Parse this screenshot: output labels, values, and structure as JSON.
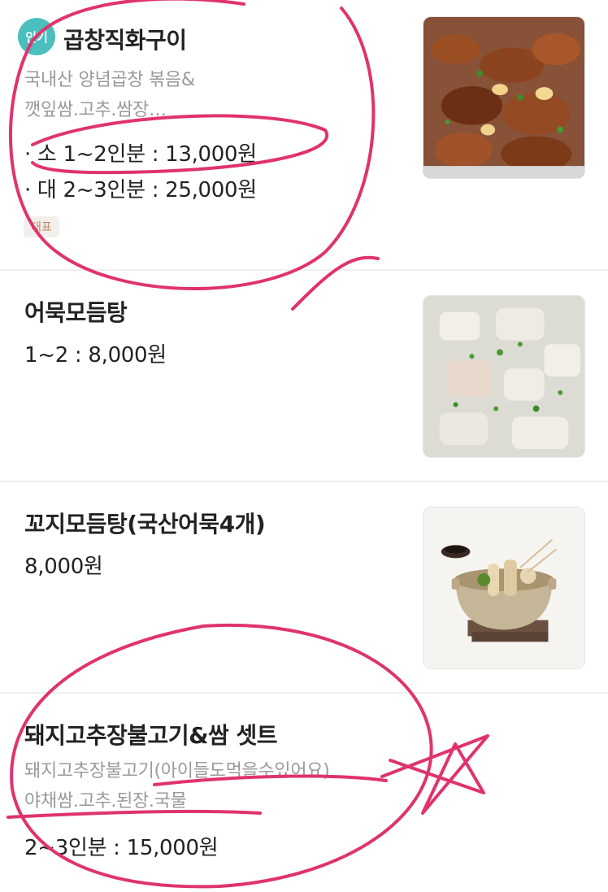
{
  "menu": [
    {
      "badge": "인기",
      "title": "곱창직화구이",
      "desc_lines": [
        "국내산 양념곱창 볶음&",
        "깻잎쌈.고추.쌈장…"
      ],
      "prices": [
        "· 소 1~2인분 : 13,000원",
        "· 대 2~3인분 : 25,000원"
      ],
      "tag": "대표",
      "image_icon": "grilled-gopchang-photo"
    },
    {
      "title": "어묵모듬탕",
      "prices": [
        "1~2 : 8,000원"
      ],
      "image_icon": "fishcake-soup-photo"
    },
    {
      "title": "꼬지모듬탕(국산어묵4개)",
      "prices": [
        "8,000원"
      ],
      "image_icon": "skewer-fishcake-pot-photo"
    },
    {
      "title": "돼지고추장불고기&쌈 셋트",
      "desc_lines": [
        "돼지고추장불고기(아이들도먹을수있어요)",
        "야채쌈.고추.된장.국물"
      ],
      "prices": [
        "2~3인분 : 15,000원"
      ]
    }
  ],
  "colors": {
    "popular_badge": "#4bbfbd",
    "rep_tag_bg": "#f3efec",
    "rep_tag_text": "#c08a6a",
    "annotation_ink": "#e0336e"
  }
}
